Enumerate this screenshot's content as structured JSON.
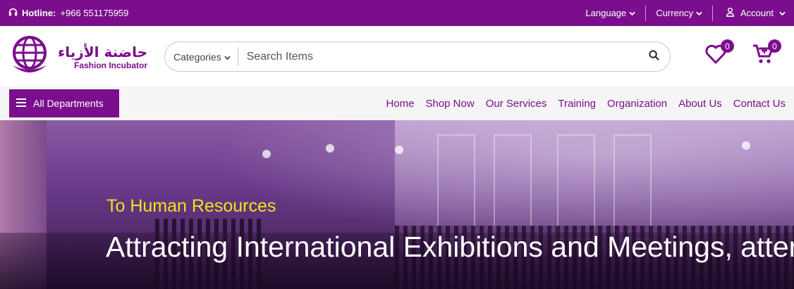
{
  "topbar": {
    "hotline_label": "Hotline:",
    "hotline_number": "+966 551175959",
    "language": "Language",
    "currency": "Currency",
    "account": "Account"
  },
  "brand": {
    "name_ar": "حاضنة الأزياء",
    "name_en": "Fashion Incubator",
    "color": "#7b0e8c"
  },
  "search": {
    "categories_label": "Categories",
    "placeholder": "Search Items"
  },
  "header_icons": {
    "wishlist_count": "0",
    "cart_count": "0"
  },
  "nav": {
    "all_departments": "All Departments",
    "items": [
      {
        "label": "Home"
      },
      {
        "label": "Shop Now"
      },
      {
        "label": "Our Services"
      },
      {
        "label": "Training"
      },
      {
        "label": "Organization"
      },
      {
        "label": "About Us"
      },
      {
        "label": "Contact Us"
      }
    ]
  },
  "hero": {
    "subtitle": "To Human Resources",
    "title": "Attracting International Exhibitions and Meetings, attending conferences and Exhibitions",
    "subtitle_color": "#f2e11b"
  }
}
